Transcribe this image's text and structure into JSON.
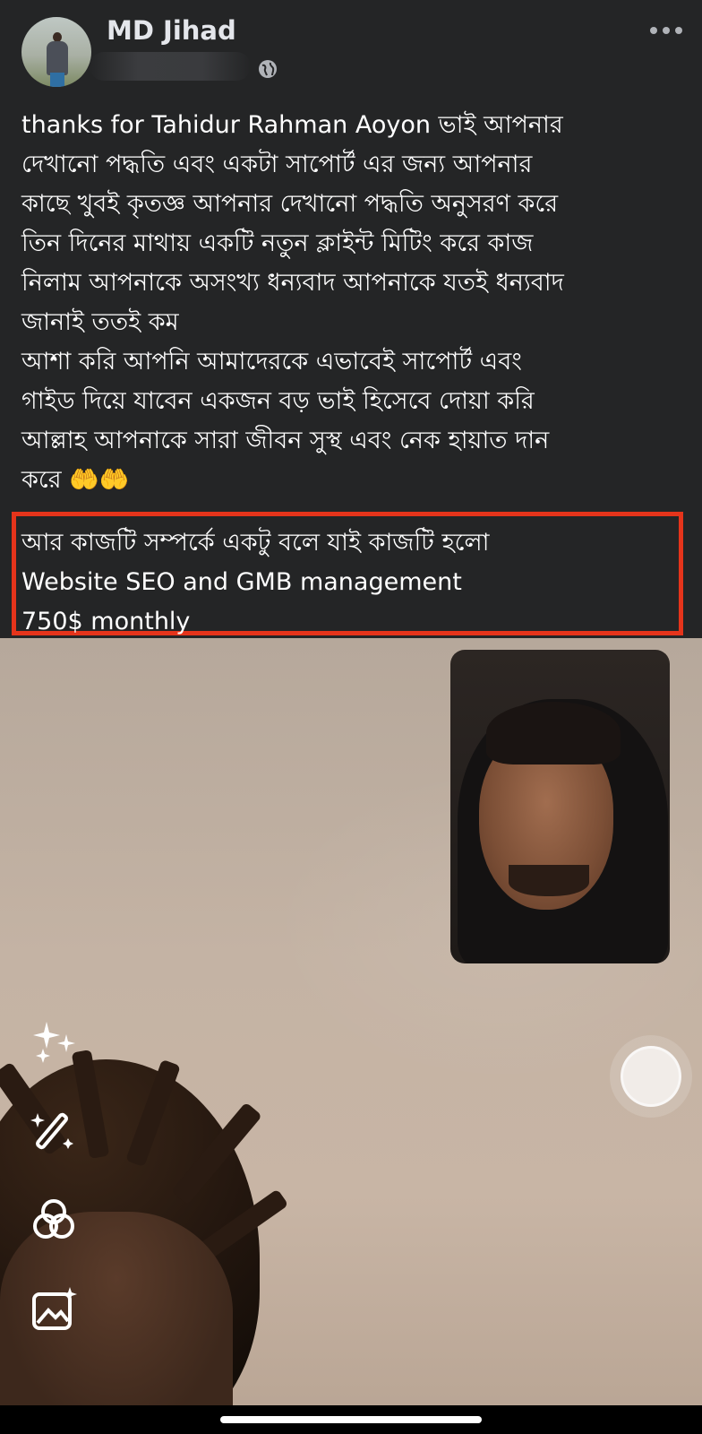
{
  "post": {
    "author_name": "MD Jihad",
    "visibility_icon": "globe-icon",
    "more_icon": "more-horizontal-icon",
    "paragraph_1": "thanks for Tahidur Rahman Aoyon ভাই আপনার\nদেখানো পদ্ধতি এবং একটা সাপোর্ট এর জন্য আপনার\nকাছে খুবই কৃতজ্ঞ আপনার দেখানো পদ্ধতি অনুসরণ করে\nতিন দিনের মাথায় একটি নতুন ক্লাইন্ট মিটিং করে কাজ\nনিলাম আপনাকে অসংখ্য ধন্যবাদ আপনাকে যতই ধন্যবাদ\nজানাই ততই কম",
    "paragraph_2": "আশা করি আপনি আমাদেরকে এভাবেই সাপোর্ট এবং\nগাইড দিয়ে যাবেন একজন বড় ভাই হিসেবে দোয়া করি\nআল্লাহ আপনাকে সারা জীবন সুস্থ এবং নেক হায়াত দান\nকরে 🤲🤲",
    "highlight_text": "আর কাজটি সম্পর্কে একটু বলে যাই কাজটি হলো\nWebsite SEO and GMB management\n750$ monthly"
  },
  "colors": {
    "background": "#242526",
    "text": "#ffffff",
    "highlight_border": "#e5341b"
  },
  "camera_tools": [
    "sparkles-icon",
    "magic-wand-icon",
    "filters-icon",
    "gallery-icon"
  ],
  "shutter_icon": "capture-button"
}
